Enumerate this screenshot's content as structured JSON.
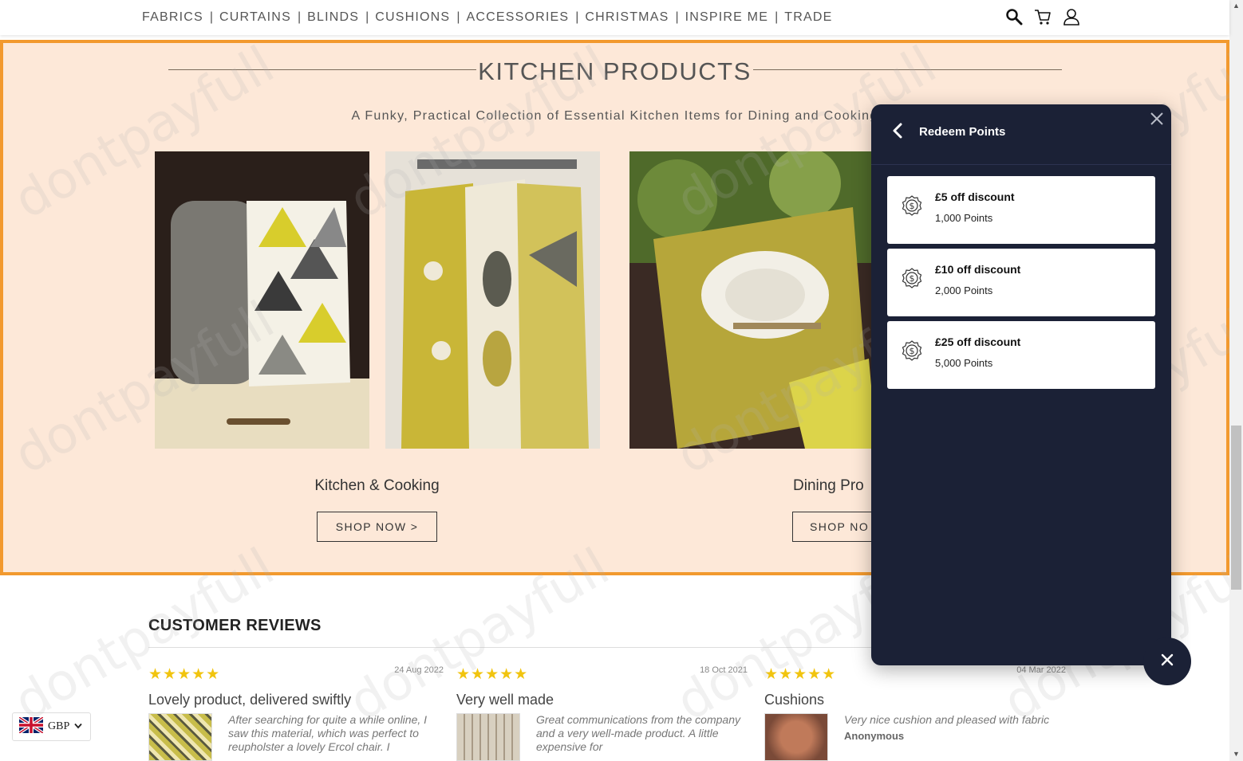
{
  "nav": {
    "items": [
      "FABRICS",
      "CURTAINS",
      "BLINDS",
      "CUSHIONS",
      "ACCESSORIES",
      "CHRISTMAS",
      "INSPIRE ME",
      "TRADE"
    ],
    "separator": "|",
    "icons": [
      "search-icon",
      "cart-icon",
      "user-icon"
    ]
  },
  "kitchen": {
    "title": "KITCHEN PRODUCTS",
    "subtitle": "A Funky, Practical Collection of Essential Kitchen Items for Dining and Cooking",
    "categories": [
      {
        "label": "Kitchen & Cooking",
        "button": "SHOP NOW >"
      },
      {
        "label": "Dining Pro",
        "button": "SHOP NO"
      }
    ]
  },
  "reviews": {
    "heading": "CUSTOMER REVIEWS",
    "items": [
      {
        "stars": "★★★★★",
        "date": "24 Aug 2022",
        "title": "Lovely product, delivered swiftly",
        "text": "After searching for quite a while online, I saw this material, which was perfect to reupholster a lovely Ercol chair. I",
        "author": ""
      },
      {
        "stars": "★★★★★",
        "date": "18 Oct 2021",
        "title": "Very well made",
        "text": "Great communications from the company and a very well-made product. A little expensive for",
        "author": ""
      },
      {
        "stars": "★★★★★",
        "date": "04 Mar 2022",
        "title": "Cushions",
        "text": "Very nice cushion and pleased with fabric",
        "author": "Anonymous"
      }
    ]
  },
  "currency": {
    "code": "GBP"
  },
  "watermark": "dontpayfull",
  "redeem": {
    "title": "Redeem Points",
    "rewards": [
      {
        "name": "£5 off discount",
        "points": "1,000 Points"
      },
      {
        "name": "£10 off discount",
        "points": "2,000 Points"
      },
      {
        "name": "£25 off discount",
        "points": "5,000 Points"
      }
    ]
  },
  "colors": {
    "accent_orange": "#f2992e",
    "panel_bg": "#1b2136",
    "section_bg": "#fde8d8",
    "star": "#f1c40f"
  }
}
